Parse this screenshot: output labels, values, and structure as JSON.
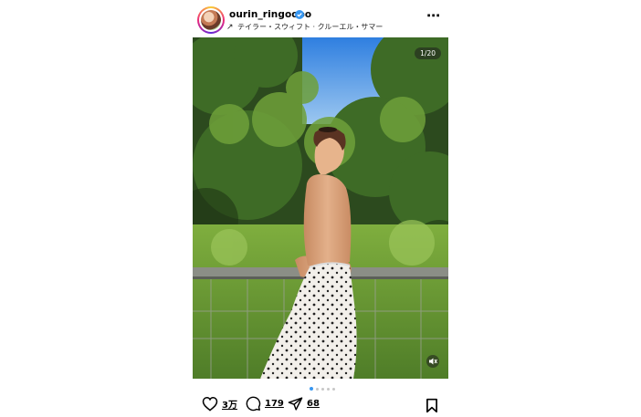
{
  "post": {
    "username": "ourin_ringoooo",
    "music": "テイラー・スウィフト · クルーエル・サマー",
    "counter": "1/20",
    "carousel": {
      "total_dots": 5,
      "active_index": 0
    },
    "likes": "3万",
    "comments": "179",
    "shares": "68"
  },
  "icons": [
    "verified-icon",
    "music-arrow-icon",
    "more-icon",
    "mute-icon",
    "heart-icon",
    "comment-icon",
    "share-icon",
    "bookmark-icon"
  ],
  "colors": {
    "verified": "#3897f0",
    "dot_active": "#3897f0",
    "dot_inactive": "#c7c7c7"
  }
}
